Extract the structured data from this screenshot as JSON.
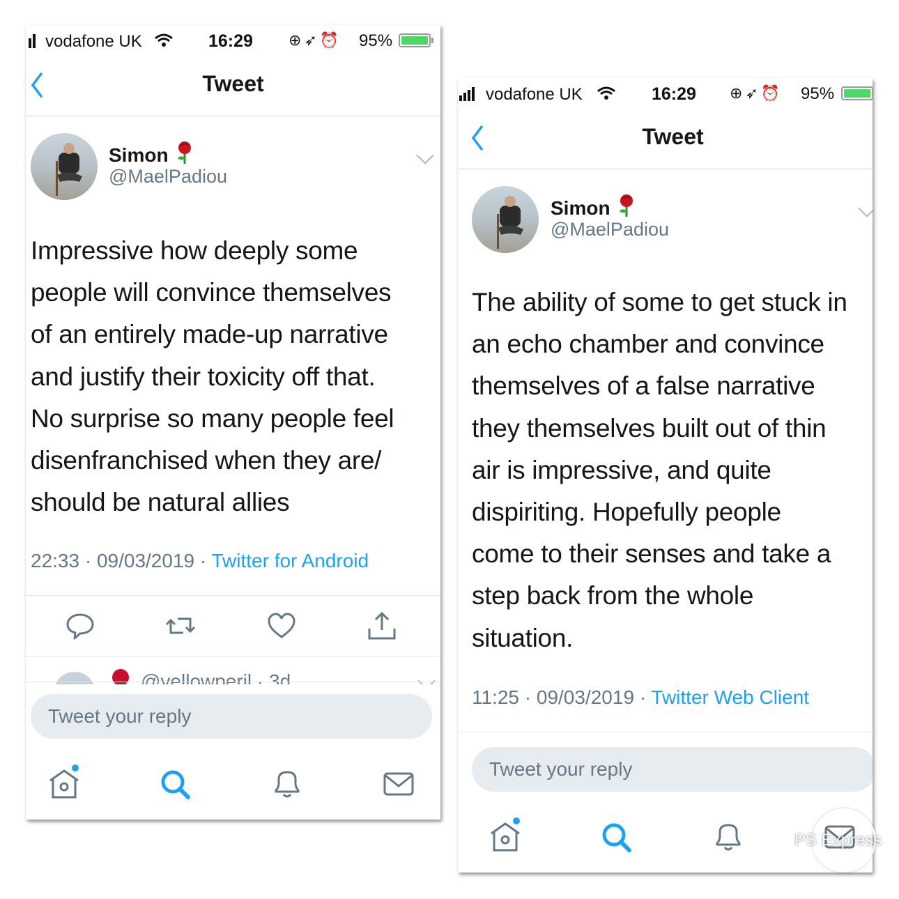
{
  "colors": {
    "accent": "#1da1f2",
    "secondary_text": "#657786",
    "battery_green": "#4cd964",
    "reply_box_bg": "#e6ecf0"
  },
  "left": {
    "status": {
      "carrier": "vodafone UK",
      "time": "16:29",
      "battery": "95%",
      "battery_level": 0.95
    },
    "nav": {
      "title": "Tweet"
    },
    "author": {
      "name": "Simon",
      "handle": "@MaelPadiou",
      "emoji": "rose"
    },
    "tweet": {
      "lines": [
        "Impressive how deeply some",
        "people will convince themselves",
        "of an entirely made-up narrative",
        "and justify their toxicity off that.",
        "No surprise so many people feel",
        "disenfranchised when they are/",
        "should be natural allies"
      ],
      "time": "22:33 · 09/03/2019 · ",
      "source": "Twitter for Android"
    },
    "actions": [
      "reply-icon",
      "retweet-icon",
      "like-icon",
      "share-icon"
    ],
    "reply_peek": "@yellowperil · 3d",
    "reply_placeholder": "Tweet your reply",
    "tabs": [
      "home-icon",
      "search-icon",
      "notifications-icon",
      "messages-icon"
    ]
  },
  "right": {
    "status": {
      "carrier": "vodafone UK",
      "time": "16:29",
      "battery": "95%",
      "battery_level": 0.95
    },
    "nav": {
      "title": "Tweet"
    },
    "author": {
      "name": "Simon",
      "handle": "@MaelPadiou",
      "emoji": "rose"
    },
    "tweet": {
      "lines": [
        "The ability of some to get stuck in",
        "an echo chamber and convince",
        "themselves of a false narrative",
        "they themselves built out of thin",
        "air is impressive, and quite",
        "dispiriting. Hopefully people",
        "come to their senses and take a",
        "step back from the whole",
        "situation."
      ],
      "time": "11:25 · 09/03/2019 · ",
      "source": "Twitter Web Client"
    },
    "reply_placeholder": "Tweet your reply",
    "tabs": [
      "home-icon",
      "search-icon",
      "notifications-icon",
      "messages-icon"
    ]
  },
  "watermark": "PS Express"
}
